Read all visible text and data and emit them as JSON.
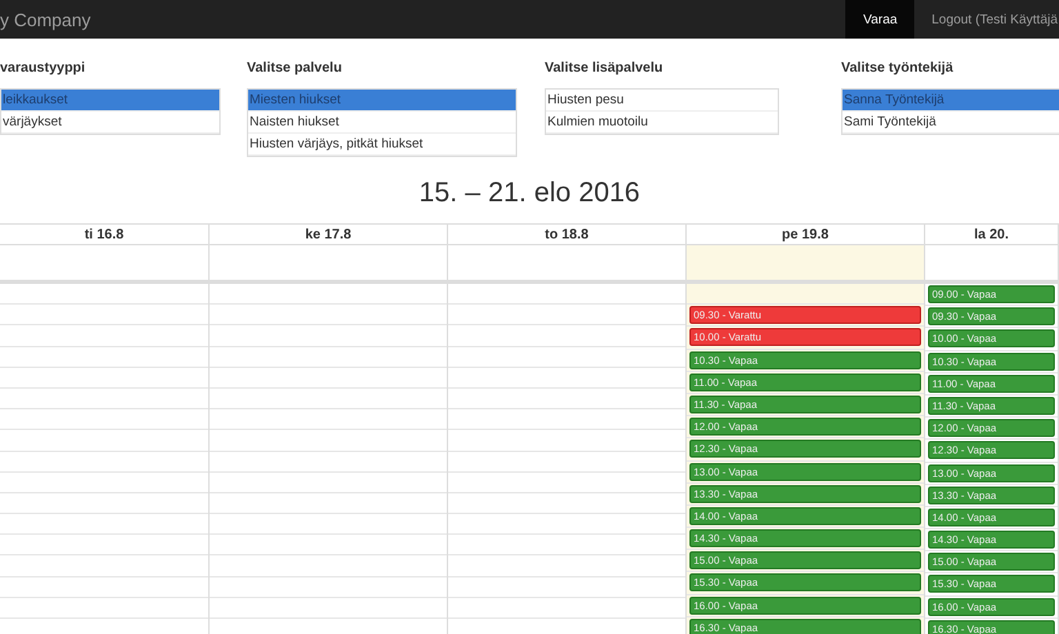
{
  "navbar": {
    "brand": "y Company",
    "items": [
      {
        "label": "Varaa",
        "selected": true
      },
      {
        "label": "Logout (Testi Käyttäjä",
        "selected": false
      }
    ]
  },
  "filters": [
    {
      "title": "varaustyyppi",
      "options": [
        {
          "label": "leikkaukset",
          "selected": true
        },
        {
          "label": "värjäykset",
          "selected": false
        }
      ]
    },
    {
      "title": "Valitse palvelu",
      "options": [
        {
          "label": "Miesten hiukset",
          "selected": true
        },
        {
          "label": "Naisten hiukset",
          "selected": false
        },
        {
          "label": "Hiusten värjäys, pitkät hiukset",
          "selected": false
        }
      ]
    },
    {
      "title": "Valitse lisäpalvelu",
      "options": [
        {
          "label": "Hiusten pesu",
          "selected": false
        },
        {
          "label": "Kulmien muotoilu",
          "selected": false
        }
      ]
    },
    {
      "title": "Valitse työntekijä",
      "options": [
        {
          "label": "Sanna Työntekijä",
          "selected": true
        },
        {
          "label": "Sami Työntekijä",
          "selected": false
        }
      ]
    }
  ],
  "calendar": {
    "title": "15. – 21. elo 2016",
    "days": [
      {
        "header": "ti 16.8",
        "today": false,
        "slots": [
          {
            "kind": "empty"
          },
          {
            "kind": "empty"
          },
          {
            "kind": "empty"
          },
          {
            "kind": "empty"
          },
          {
            "kind": "empty"
          },
          {
            "kind": "empty"
          },
          {
            "kind": "empty"
          },
          {
            "kind": "empty"
          },
          {
            "kind": "empty"
          },
          {
            "kind": "empty"
          },
          {
            "kind": "empty"
          },
          {
            "kind": "empty"
          },
          {
            "kind": "empty"
          },
          {
            "kind": "empty"
          },
          {
            "kind": "empty"
          },
          {
            "kind": "empty"
          }
        ]
      },
      {
        "header": "ke 17.8",
        "today": false,
        "slots": [
          {
            "kind": "empty"
          },
          {
            "kind": "empty"
          },
          {
            "kind": "empty"
          },
          {
            "kind": "empty"
          },
          {
            "kind": "empty"
          },
          {
            "kind": "empty"
          },
          {
            "kind": "empty"
          },
          {
            "kind": "empty"
          },
          {
            "kind": "empty"
          },
          {
            "kind": "empty"
          },
          {
            "kind": "empty"
          },
          {
            "kind": "empty"
          },
          {
            "kind": "empty"
          },
          {
            "kind": "empty"
          },
          {
            "kind": "empty"
          },
          {
            "kind": "empty"
          }
        ]
      },
      {
        "header": "to 18.8",
        "today": false,
        "slots": [
          {
            "kind": "empty"
          },
          {
            "kind": "empty"
          },
          {
            "kind": "empty"
          },
          {
            "kind": "empty"
          },
          {
            "kind": "empty"
          },
          {
            "kind": "empty"
          },
          {
            "kind": "empty"
          },
          {
            "kind": "empty"
          },
          {
            "kind": "empty"
          },
          {
            "kind": "empty"
          },
          {
            "kind": "empty"
          },
          {
            "kind": "empty"
          },
          {
            "kind": "empty"
          },
          {
            "kind": "empty"
          },
          {
            "kind": "empty"
          },
          {
            "kind": "empty"
          }
        ]
      },
      {
        "header": "pe 19.8",
        "today": true,
        "slots": [
          {
            "kind": "empty"
          },
          {
            "kind": "booked",
            "label": "09.30 - Varattu"
          },
          {
            "kind": "booked",
            "label": "10.00 - Varattu"
          },
          {
            "kind": "free",
            "label": "10.30 - Vapaa"
          },
          {
            "kind": "free",
            "label": "11.00 - Vapaa"
          },
          {
            "kind": "free",
            "label": "11.30 - Vapaa"
          },
          {
            "kind": "free",
            "label": "12.00 - Vapaa"
          },
          {
            "kind": "free",
            "label": "12.30 - Vapaa"
          },
          {
            "kind": "free",
            "label": "13.00 - Vapaa"
          },
          {
            "kind": "free",
            "label": "13.30 - Vapaa"
          },
          {
            "kind": "free",
            "label": "14.00 - Vapaa"
          },
          {
            "kind": "free",
            "label": "14.30 - Vapaa"
          },
          {
            "kind": "free",
            "label": "15.00 - Vapaa"
          },
          {
            "kind": "free",
            "label": "15.30 - Vapaa"
          },
          {
            "kind": "free",
            "label": "16.00 - Vapaa"
          },
          {
            "kind": "free",
            "label": "16.30 - Vapaa"
          }
        ]
      },
      {
        "header": "la 20.",
        "today": false,
        "slots": [
          {
            "kind": "free",
            "label": "09.00 - Vapaa"
          },
          {
            "kind": "free",
            "label": "09.30 - Vapaa"
          },
          {
            "kind": "free",
            "label": "10.00 - Vapaa"
          },
          {
            "kind": "free",
            "label": "10.30 - Vapaa"
          },
          {
            "kind": "free",
            "label": "11.00 - Vapaa"
          },
          {
            "kind": "free",
            "label": "11.30 - Vapaa"
          },
          {
            "kind": "free",
            "label": "12.00 - Vapaa"
          },
          {
            "kind": "free",
            "label": "12.30 - Vapaa"
          },
          {
            "kind": "free",
            "label": "13.00 - Vapaa"
          },
          {
            "kind": "free",
            "label": "13.30 - Vapaa"
          },
          {
            "kind": "free",
            "label": "14.00 - Vapaa"
          },
          {
            "kind": "free",
            "label": "14.30 - Vapaa"
          },
          {
            "kind": "free",
            "label": "15.00 - Vapaa"
          },
          {
            "kind": "free",
            "label": "15.30 - Vapaa"
          },
          {
            "kind": "free",
            "label": "16.00 - Vapaa"
          },
          {
            "kind": "free",
            "label": "16.30 - Vapaa"
          }
        ]
      }
    ]
  }
}
